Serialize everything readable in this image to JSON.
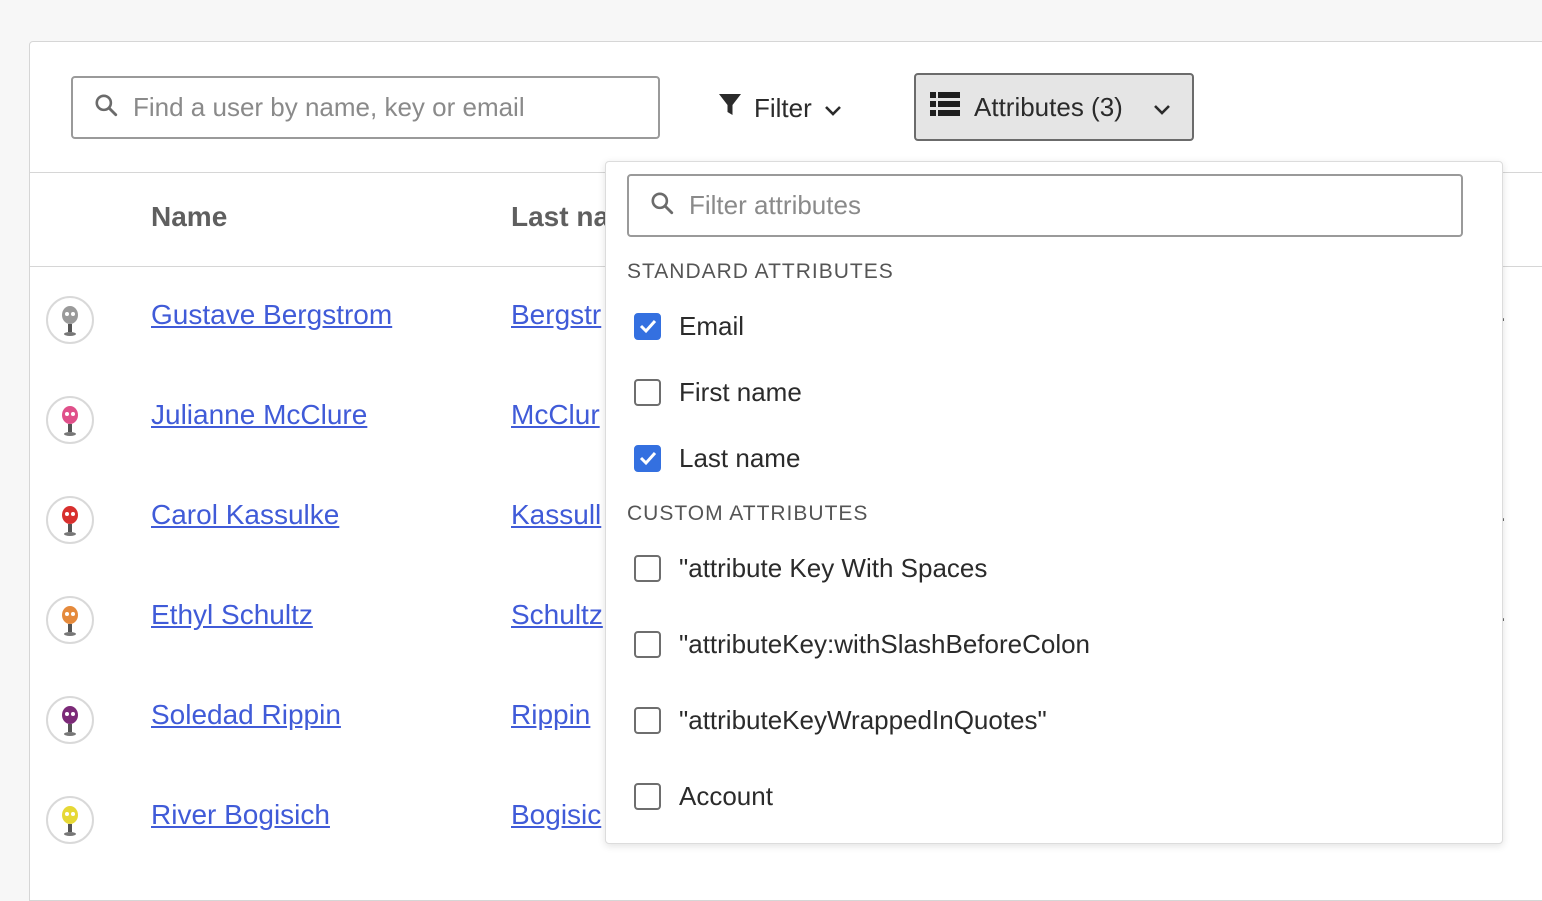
{
  "toolbar": {
    "search_placeholder": "Find a user by name, key or email",
    "filter_label": "Filter",
    "attributes_label": "Attributes (3)"
  },
  "table": {
    "headers": {
      "name": "Name",
      "last_name": "Last na"
    },
    "rows": [
      {
        "name": "Gustave Bergstrom",
        "last_name": "Bergstr",
        "avatar_color": "#9a9a9a",
        "trail": "."
      },
      {
        "name": "Julianne McClure",
        "last_name": "McClur",
        "avatar_color": "#e0508a",
        "trail": ""
      },
      {
        "name": "Carol Kassulke",
        "last_name": "Kassull",
        "avatar_color": "#d8302e",
        "trail": "."
      },
      {
        "name": "Ethyl Schultz",
        "last_name": "Schultz",
        "avatar_color": "#e58a3c",
        "trail": "."
      },
      {
        "name": "Soledad Rippin",
        "last_name": "Rippin",
        "avatar_color": "#7c2a78",
        "trail": ""
      },
      {
        "name": "River Bogisich",
        "last_name": "Bogisic",
        "avatar_color": "#e6d836",
        "trail": ""
      }
    ]
  },
  "attributes_menu": {
    "search_placeholder": "Filter attributes",
    "standard_title": "STANDARD ATTRIBUTES",
    "standard": [
      {
        "label": "Email",
        "checked": true
      },
      {
        "label": "First name",
        "checked": false
      },
      {
        "label": "Last name",
        "checked": true
      }
    ],
    "custom_title": "CUSTOM ATTRIBUTES",
    "custom": [
      {
        "label": "\"attribute Key With Spaces",
        "checked": false
      },
      {
        "label": "\"attributeKey:withSlashBeforeColon",
        "checked": false
      },
      {
        "label": "\"attributeKeyWrappedInQuotes\"",
        "checked": false
      },
      {
        "label": "Account",
        "checked": false
      }
    ]
  },
  "colors": {
    "link": "#405bd8",
    "accent": "#3470e0"
  },
  "icons": [
    "search-icon",
    "filter-icon",
    "chevron-down-icon",
    "list-icon",
    "check-icon"
  ]
}
